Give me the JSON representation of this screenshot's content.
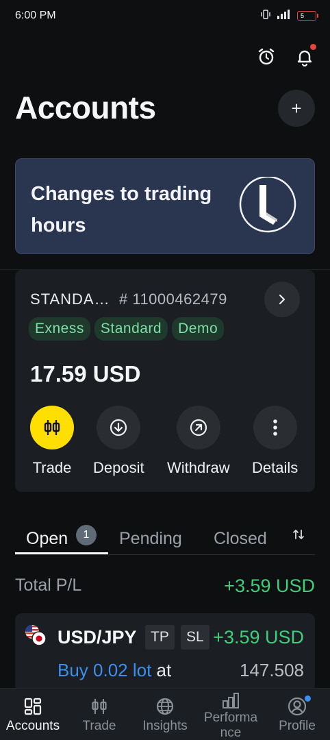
{
  "status_bar": {
    "time": "6:00 PM",
    "battery": "5"
  },
  "header": {
    "title": "Accounts",
    "add_label": "+"
  },
  "banner": {
    "text": "Changes to trading hours"
  },
  "account": {
    "type": "STANDA…",
    "number": "# 11000462479",
    "tags": [
      "Exness",
      "Standard",
      "Demo"
    ],
    "balance": "17.59 USD",
    "actions": [
      {
        "label": "Trade",
        "icon": "candlestick-icon"
      },
      {
        "label": "Deposit",
        "icon": "arrow-down-circle-icon"
      },
      {
        "label": "Withdraw",
        "icon": "arrow-up-right-circle-icon"
      },
      {
        "label": "Details",
        "icon": "more-vertical-icon"
      }
    ]
  },
  "tabs": {
    "items": [
      "Open",
      "Pending",
      "Closed"
    ],
    "open_count": "1",
    "active": "Open"
  },
  "summary": {
    "label": "Total P/L",
    "value": "+3.59 USD"
  },
  "position": {
    "pair": "USD/JPY",
    "tp": "TP",
    "sl": "SL",
    "pl": "+3.59 USD",
    "side_lot": "Buy 0.02 lot",
    "at": "at",
    "price": "147.508"
  },
  "bottom_nav": {
    "items": [
      {
        "label": "Accounts",
        "icon": "accounts-grid-icon",
        "active": true
      },
      {
        "label": "Trade",
        "icon": "candlestick-icon",
        "active": false
      },
      {
        "label": "Insights",
        "icon": "globe-icon",
        "active": false
      },
      {
        "label": "Performa\nnce",
        "icon": "bar-chart-icon",
        "active": false
      },
      {
        "label": "Profile",
        "icon": "profile-icon",
        "active": false
      }
    ]
  },
  "colors": {
    "accent_yellow": "#ffde02",
    "profit_green": "#3ecf7a",
    "buy_blue": "#3b8ff0",
    "banner_bg": "#2a3550"
  }
}
